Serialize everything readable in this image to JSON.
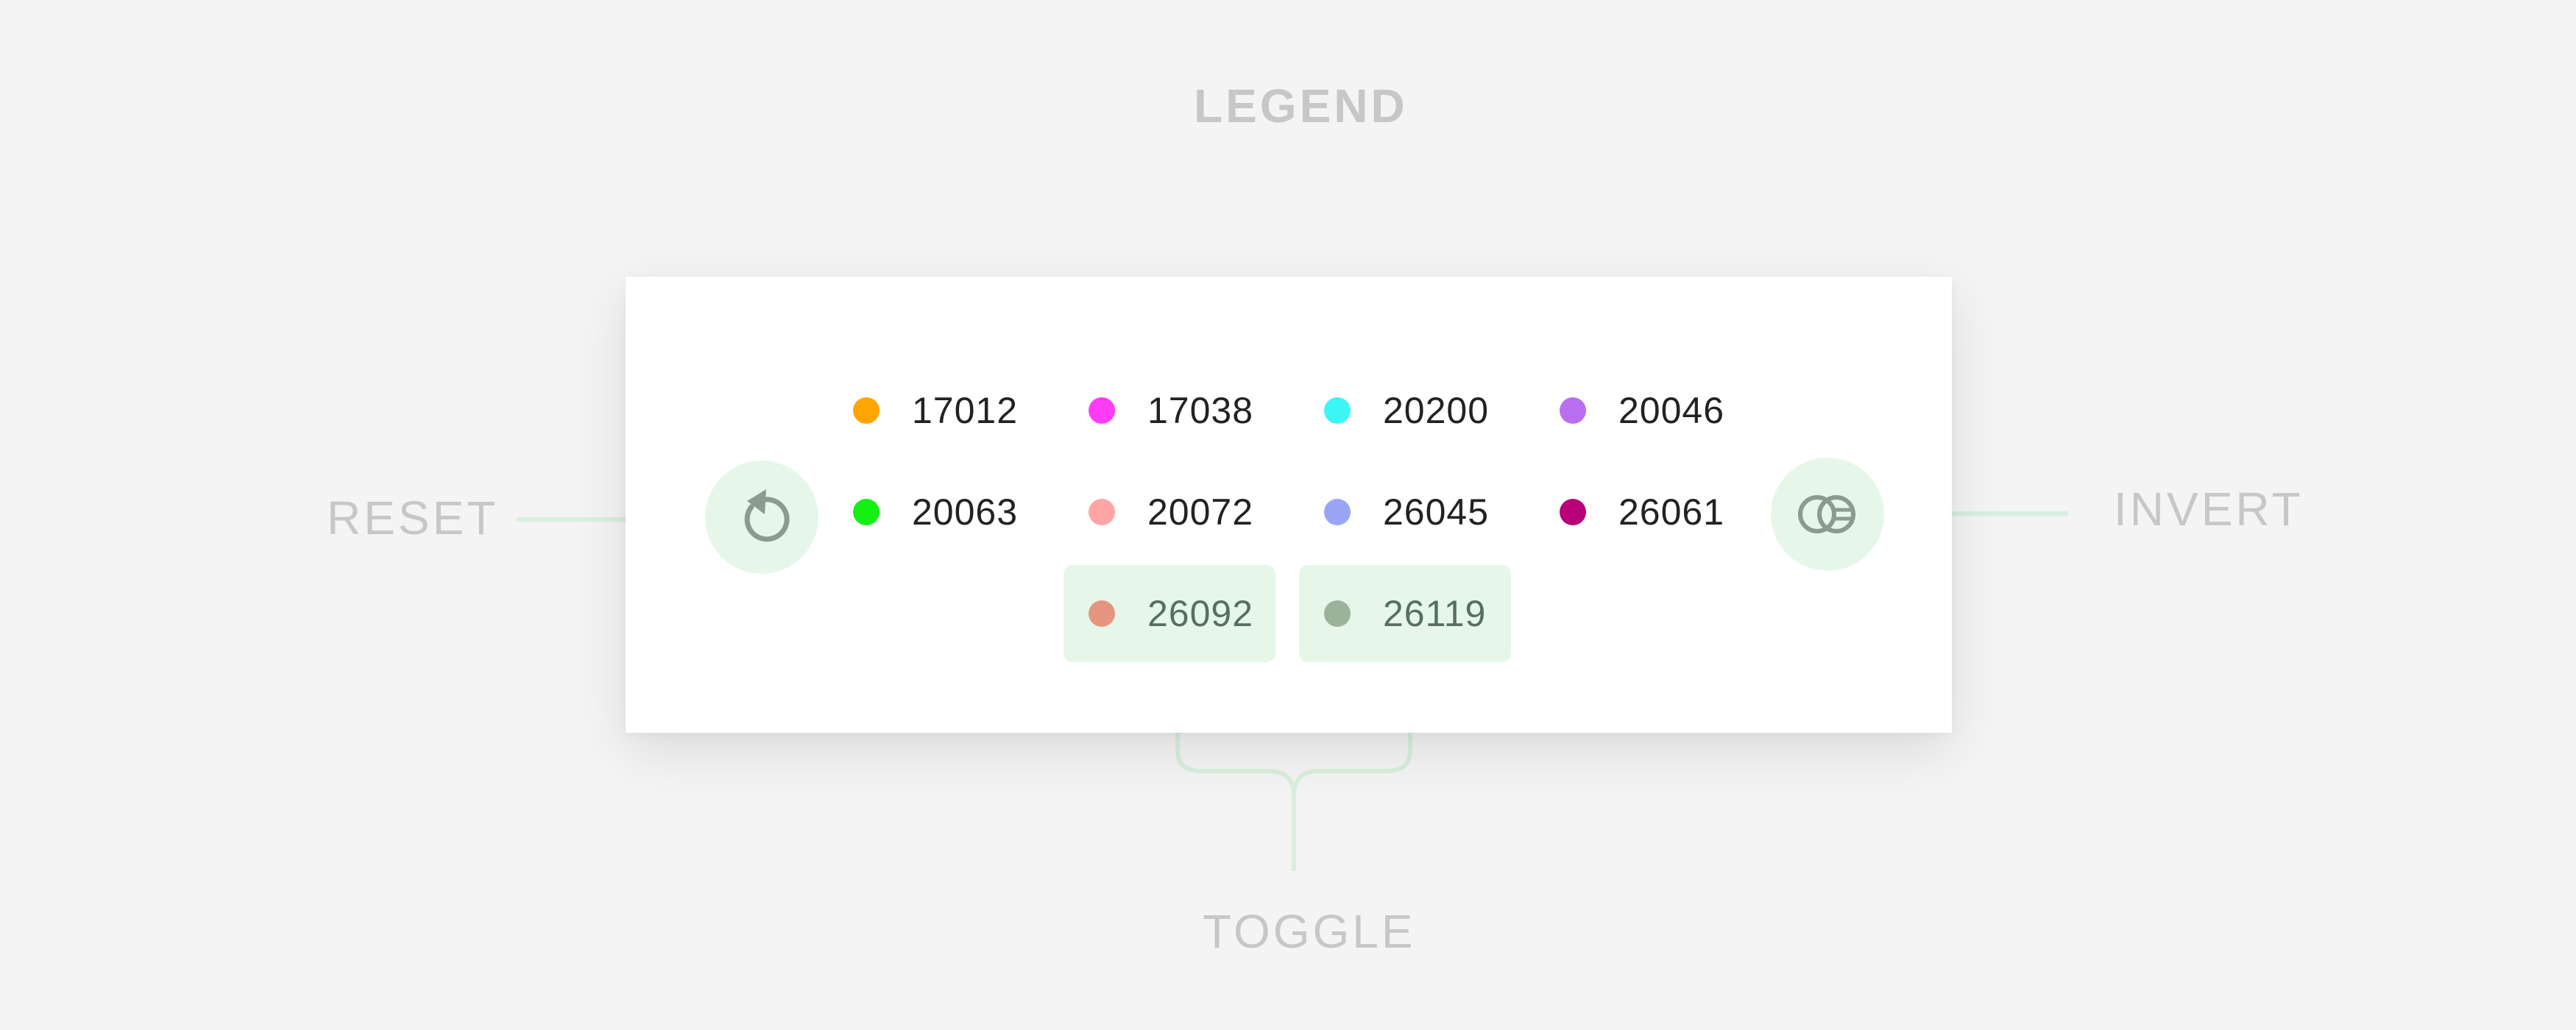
{
  "annotations": {
    "legend": "LEGEND",
    "reset": "RESET",
    "invert": "INVERT",
    "toggle": "TOGGLE"
  },
  "buttons": {
    "reset_icon": "reset-icon",
    "invert_icon": "invert-icon"
  },
  "legend": {
    "items": [
      {
        "label": "17012",
        "color": "#ffa500",
        "active": false
      },
      {
        "label": "17038",
        "color": "#ff3cf5",
        "active": false
      },
      {
        "label": "20200",
        "color": "#3cf5f5",
        "active": false
      },
      {
        "label": "20046",
        "color": "#b96ef0",
        "active": false
      },
      {
        "label": "20063",
        "color": "#14f014",
        "active": false
      },
      {
        "label": "20072",
        "color": "#ffa5a5",
        "active": false
      },
      {
        "label": "26045",
        "color": "#9ba5f5",
        "active": false
      },
      {
        "label": "26061",
        "color": "#b90078",
        "active": false
      },
      {
        "label": "26092",
        "color": "#e69680",
        "active": true
      },
      {
        "label": "26119",
        "color": "#9bb39b",
        "active": true
      }
    ]
  },
  "colors": {
    "accent_bg": "#e6f7ea",
    "connector": "#d8efdd",
    "annotation_text": "#c7c7c7",
    "icon": "#8c9a8f"
  }
}
